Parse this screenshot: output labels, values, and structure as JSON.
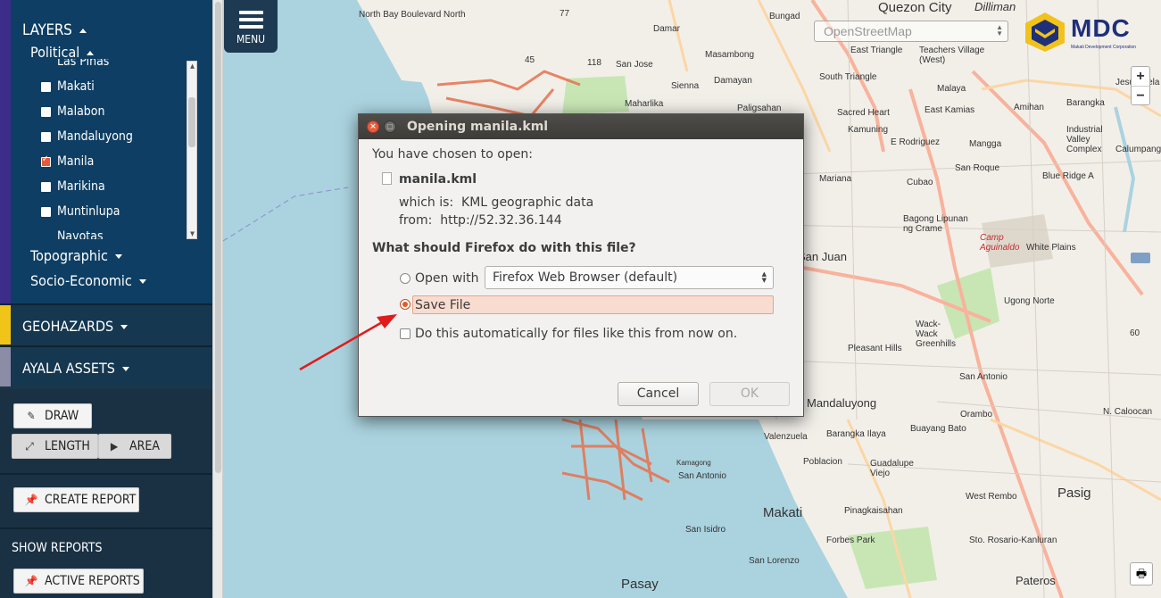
{
  "sidebar": {
    "layers_title": "LAYERS",
    "political_title": "Political",
    "political_items": [
      {
        "label": "Las Piñas",
        "checked": false
      },
      {
        "label": "Makati",
        "checked": false
      },
      {
        "label": "Malabon",
        "checked": false
      },
      {
        "label": "Mandaluyong",
        "checked": false
      },
      {
        "label": "Manila",
        "checked": true
      },
      {
        "label": "Marikina",
        "checked": false
      },
      {
        "label": "Muntinlupa",
        "checked": false
      },
      {
        "label": "Navotas",
        "checked": false
      }
    ],
    "topographic": "Topographic",
    "socio_economic": "Socio-Economic",
    "geohazards": "GEOHAZARDS",
    "ayala_assets": "AYALA ASSETS",
    "draw": "DRAW",
    "length": "LENGTH",
    "area": "AREA",
    "create_report": "CREATE REPORT",
    "show_reports": "SHOW REPORTS",
    "active_reports": "ACTIVE REPORTS"
  },
  "map": {
    "menu_label": "MENU",
    "base_layer": "OpenStreetMap",
    "logo_text": "MDC",
    "logo_sub": "Makati Development Corporation",
    "zoom_in": "+",
    "zoom_out": "−",
    "labels": {
      "north_bay": "North Bay Boulevard North",
      "quezon_city": "Quezon City",
      "dilliman": "Dilliman",
      "bungad": "Bungad",
      "damar": "Damar",
      "masambong": "Masambong",
      "damayan": "Damayan",
      "sienna": "Sienna",
      "maharlika": "Maharlika",
      "san_jose": "San Jose",
      "paligsahan": "Paligsahan",
      "east_triangle": "East Triangle",
      "south_triangle": "South Triangle",
      "teachers_village": "Teachers Village (West)",
      "malaya": "Malaya",
      "east_kamias": "East Kamias",
      "amihan": "Amihan",
      "sacred_heart": "Sacred Heart",
      "kamuning": "Kamuning",
      "e_rodriguez": "E Rodriguez",
      "mangga": "Mangga",
      "san_roque": "San Roque",
      "cubao": "Cubao",
      "blue_ridge": "Blue Ridge A",
      "mariana": "Mariana",
      "bagong_lipunan": "Bagong Lipunan ng Crame",
      "camp_aguinaldo": "Camp Aguinaldo",
      "white_plains": "White Plains",
      "san_juan": "San Juan",
      "ugong_norte": "Ugong Norte",
      "wack_wack": "Wack-Wack Greenhills",
      "pleasant_hills": "Pleasant Hills",
      "san_antonio": "San Antonio",
      "mandaluyong": "Mandaluyong",
      "orambo": "Orambo",
      "buayang_bato": "Buayang Bato",
      "barangka_ilaya": "Barangka Ilaya",
      "valenzuela": "Valenzuela",
      "poblacion": "Poblacion",
      "guadalupe_viejo": "Guadalupe Viejo",
      "west_rembo": "West Rembo",
      "pasig": "Pasig",
      "makati": "Makati",
      "pinagkaisahan": "Pinagkaisahan",
      "forbes_park": "Forbes Park",
      "san_lorenzo": "San Lorenzo",
      "pasay": "Pasay",
      "san_isidro": "San Isidro",
      "san_antonio2": "San Antonio",
      "kamagong": "Kamagong",
      "sto_rosario": "Sto. Rosario-Kanluran",
      "pateros": "Pateros",
      "barangka": "Barangka",
      "jesus_dela": "Jesus Dela",
      "industrial_valley": "Industrial Valley Complex",
      "calumpang": "Calumpang",
      "n_caloocan": "N. Caloocan",
      "n118": "118",
      "n45": "45",
      "n60": "60",
      "n77": "77"
    }
  },
  "dialog": {
    "title": "Opening manila.kml",
    "chosen": "You have chosen to open:",
    "filename": "manila.kml",
    "which_is_label": "which is:",
    "which_is_value": "KML geographic data",
    "from_label": "from:",
    "from_value": "http://52.32.36.144",
    "question": "What should Firefox do with this file?",
    "open_with": "Open with",
    "open_with_app": "Firefox Web Browser (default)",
    "save_file": "Save File",
    "auto": "Do this automatically for files like this from now on.",
    "cancel": "Cancel",
    "ok": "OK"
  }
}
